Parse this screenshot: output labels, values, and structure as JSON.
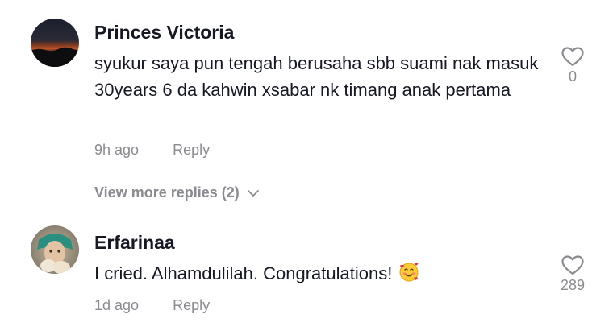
{
  "comments": [
    {
      "username": "Princes Victoria",
      "text": "syukur saya pun tengah berusaha sbb suami nak masuk 30years 6 da kahwin xsabar nk timang anak pertama",
      "time": "9h ago",
      "reply_label": "Reply",
      "like_count": "0",
      "view_more_label": "View more replies (2)"
    },
    {
      "username": "Erfarinaa",
      "text": "I cried. Alhamdulilah. Congratulations!",
      "emoji": "smiling-face-with-hearts",
      "time": "1d ago",
      "reply_label": "Reply",
      "like_count": "289"
    }
  ],
  "colors": {
    "primary_text": "#161823",
    "secondary_text": "#8a8b91",
    "background": "#ffffff"
  }
}
